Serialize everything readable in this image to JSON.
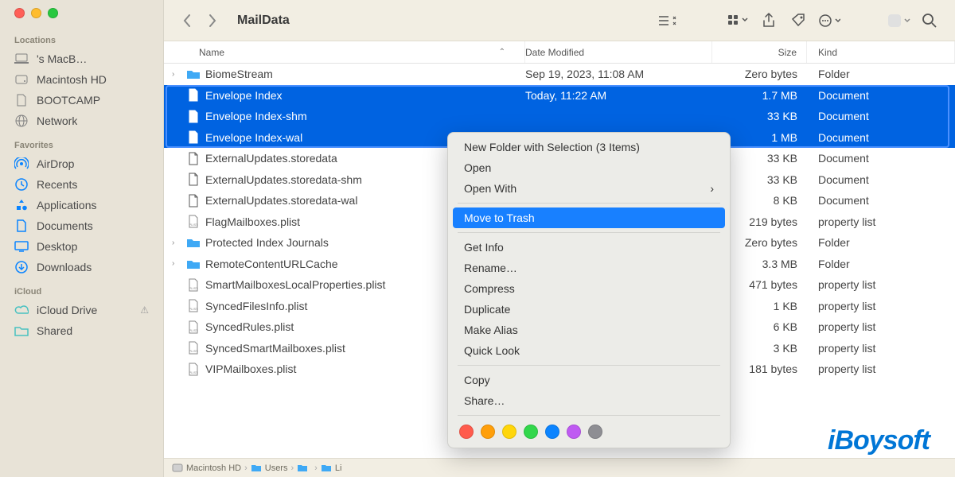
{
  "window": {
    "title": "MailData"
  },
  "sidebar": {
    "sections": [
      {
        "header": "Locations",
        "items": [
          {
            "id": "macbook",
            "icon": "laptop",
            "label": "'s MacB…"
          },
          {
            "id": "macintosh-hd",
            "icon": "hdd",
            "label": "Macintosh HD"
          },
          {
            "id": "bootcamp",
            "icon": "doc",
            "label": "BOOTCAMP"
          },
          {
            "id": "network",
            "icon": "globe",
            "label": "Network"
          }
        ]
      },
      {
        "header": "Favorites",
        "items": [
          {
            "id": "airdrop",
            "icon": "airdrop",
            "label": "AirDrop"
          },
          {
            "id": "recents",
            "icon": "clock",
            "label": "Recents"
          },
          {
            "id": "applications",
            "icon": "apps",
            "label": "Applications"
          },
          {
            "id": "documents",
            "icon": "doc",
            "label": "Documents"
          },
          {
            "id": "desktop",
            "icon": "desktop",
            "label": "Desktop"
          },
          {
            "id": "downloads",
            "icon": "download",
            "label": "Downloads"
          }
        ]
      },
      {
        "header": "iCloud",
        "items": [
          {
            "id": "icloud-drive",
            "icon": "cloud",
            "label": "iCloud Drive",
            "warn": true
          },
          {
            "id": "shared",
            "icon": "folder",
            "label": "Shared"
          }
        ]
      }
    ]
  },
  "columns": {
    "name": "Name",
    "date": "Date Modified",
    "size": "Size",
    "kind": "Kind"
  },
  "files": [
    {
      "name": "BiomeStream",
      "date": "Sep 19, 2023, 11:08 AM",
      "size": "Zero bytes",
      "kind": "Folder",
      "icon": "folder",
      "disclosure": true
    },
    {
      "name": "Envelope Index",
      "date": "Today, 11:22 AM",
      "size": "1.7 MB",
      "kind": "Document",
      "icon": "doc",
      "selected": true
    },
    {
      "name": "Envelope Index-shm",
      "date": "",
      "size": "33 KB",
      "kind": "Document",
      "icon": "doc",
      "selected": true
    },
    {
      "name": "Envelope Index-wal",
      "date": "",
      "size": "1 MB",
      "kind": "Document",
      "icon": "doc",
      "selected": true
    },
    {
      "name": "ExternalUpdates.storedata",
      "date": "",
      "size": "33 KB",
      "kind": "Document",
      "icon": "doc"
    },
    {
      "name": "ExternalUpdates.storedata-shm",
      "date": "",
      "size": "33 KB",
      "kind": "Document",
      "icon": "doc"
    },
    {
      "name": "ExternalUpdates.storedata-wal",
      "date": "",
      "size": "8 KB",
      "kind": "Document",
      "icon": "doc"
    },
    {
      "name": "FlagMailboxes.plist",
      "date": "",
      "size": "219 bytes",
      "kind": "property list",
      "icon": "plist"
    },
    {
      "name": "Protected Index Journals",
      "date": "",
      "size": "Zero bytes",
      "kind": "Folder",
      "icon": "folder",
      "disclosure": true
    },
    {
      "name": "RemoteContentURLCache",
      "date": "",
      "size": "3.3 MB",
      "kind": "Folder",
      "icon": "folder",
      "disclosure": true
    },
    {
      "name": "SmartMailboxesLocalProperties.plist",
      "date": "",
      "size": "471 bytes",
      "kind": "property list",
      "icon": "plist"
    },
    {
      "name": "SyncedFilesInfo.plist",
      "date": "",
      "size": "1 KB",
      "kind": "property list",
      "icon": "plist"
    },
    {
      "name": "SyncedRules.plist",
      "date": "",
      "size": "6 KB",
      "kind": "property list",
      "icon": "plist"
    },
    {
      "name": "SyncedSmartMailboxes.plist",
      "date": "",
      "size": "3 KB",
      "kind": "property list",
      "icon": "plist"
    },
    {
      "name": "VIPMailboxes.plist",
      "date": "",
      "size": "181 bytes",
      "kind": "property list",
      "icon": "plist"
    }
  ],
  "context_menu": {
    "groups": [
      [
        {
          "label": "New Folder with Selection (3 Items)"
        },
        {
          "label": "Open"
        },
        {
          "label": "Open With",
          "submenu": true
        }
      ],
      [
        {
          "label": "Move to Trash",
          "highlight": true
        }
      ],
      [
        {
          "label": "Get Info"
        },
        {
          "label": "Rename…"
        },
        {
          "label": "Compress"
        },
        {
          "label": "Duplicate"
        },
        {
          "label": "Make Alias"
        },
        {
          "label": "Quick Look"
        }
      ],
      [
        {
          "label": "Copy"
        },
        {
          "label": "Share…"
        }
      ]
    ],
    "tags": [
      "#ff5b4c",
      "#ff9f0a",
      "#ffd60a",
      "#32d74b",
      "#0b84ff",
      "#bf5af2",
      "#8e8e93"
    ]
  },
  "pathbar": [
    {
      "icon": "hdd",
      "label": "Macintosh HD"
    },
    {
      "icon": "folder",
      "label": "Users"
    },
    {
      "icon": "folder",
      "label": ""
    },
    {
      "icon": "folder",
      "label": "Li"
    }
  ],
  "logo": "iBoysoft"
}
